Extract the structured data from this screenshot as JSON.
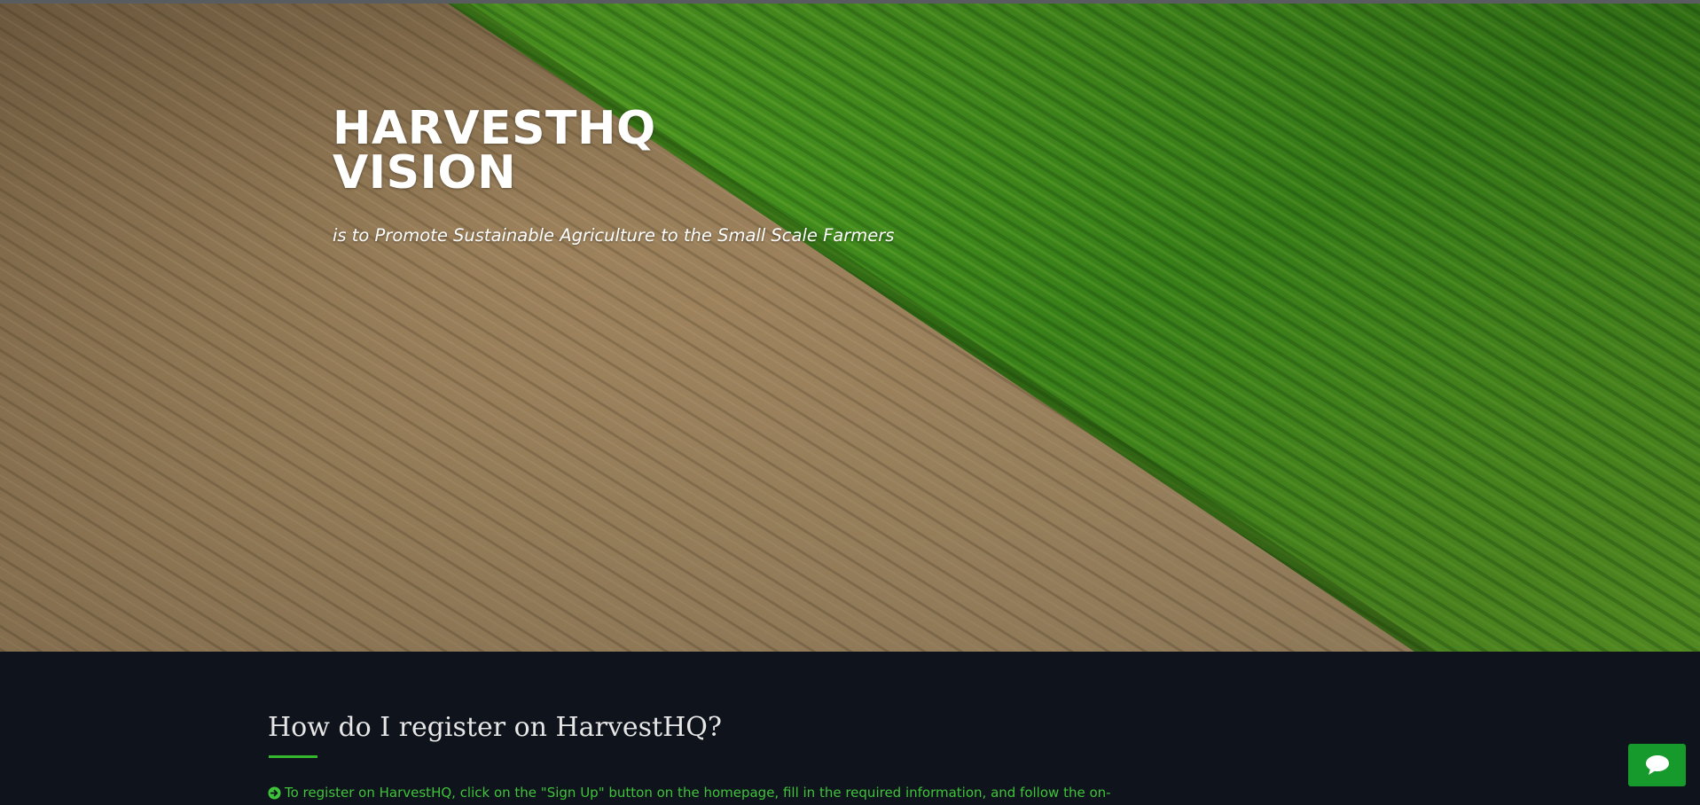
{
  "hero": {
    "title_line1": "HARVESTHQ",
    "title_line2": "VISION",
    "subtitle": "is to Promote Sustainable Agriculture to the Small Scale Farmers",
    "background_image": "aerial view of a tilled brown field beside a green crop field"
  },
  "faq": {
    "question": "How do I register on HarvestHQ?",
    "answer": "To register on HarvestHQ, click on the \"Sign Up\" button on the homepage, fill in the required information, and follow the on-",
    "answer_icon": "arrow-circle-right-icon"
  },
  "chat": {
    "icon": "chat-bubble-icon"
  },
  "colors": {
    "accent_green": "#36b82e",
    "answer_text": "#3ec33a",
    "chat_button": "#169a2c",
    "dark_background": "#0f131b"
  }
}
